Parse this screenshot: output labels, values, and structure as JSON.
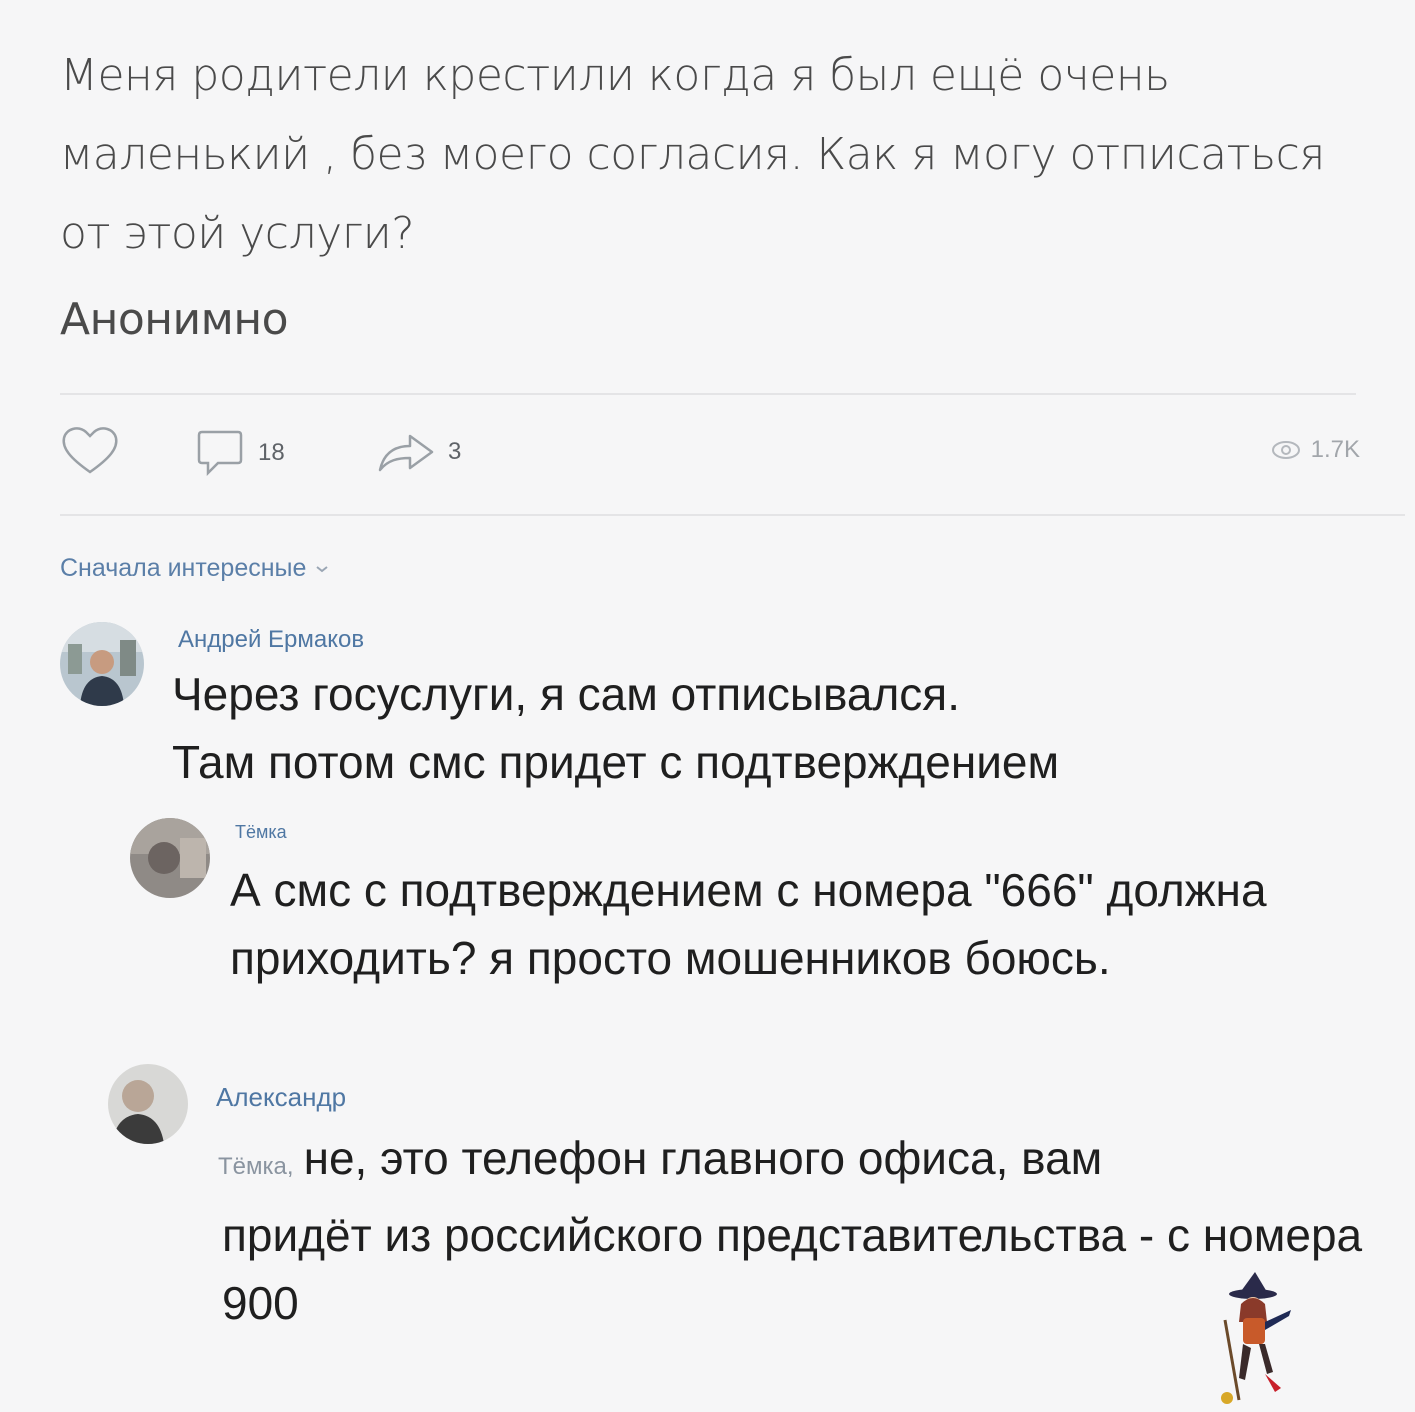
{
  "post": {
    "text": "Меня родители крестили когда я был ещё очень маленький , без моего согласия. Как я могу отписаться от этой услуги?",
    "author": "Анонимно"
  },
  "actions": {
    "comments_count": "18",
    "shares_count": "3",
    "views_count": "1.7K"
  },
  "sort_label": "Сначала интересные",
  "comments": [
    {
      "name": "Андрей Ермаков",
      "text_line1": "Через госуслуги, я сам отписывался.",
      "text_line2": "Там потом смс придет с подтверждением"
    },
    {
      "name": "Тёмка",
      "text": "А смс с подтверждением с номера \"666\" должна приходить? я просто мошенников боюсь."
    },
    {
      "name": "Александр",
      "reply_to": "Тёмка,",
      "text_first": "не, это телефон главного офиса, вам",
      "text_rest": "придёт из российского представительства - с номера 900"
    }
  ],
  "colors": {
    "link": "#4f77a3",
    "muted": "#8a8e93",
    "background": "#f6f6f7"
  }
}
